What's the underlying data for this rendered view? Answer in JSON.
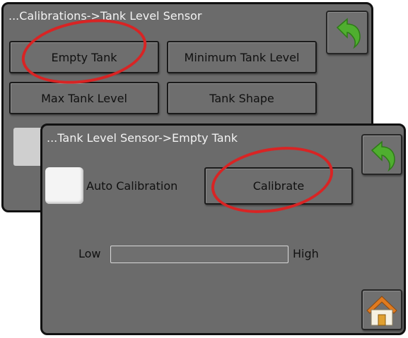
{
  "back_screen": {
    "breadcrumb": "...Calibrations->Tank Level Sensor",
    "buttons": {
      "empty_tank": "Empty Tank",
      "minimum_tank_level": "Minimum Tank Level",
      "max_tank_level": "Max Tank Level",
      "tank_shape": "Tank Shape"
    },
    "back_icon": "back-arrow-icon"
  },
  "front_screen": {
    "breadcrumb": "...Tank Level Sensor->Empty Tank",
    "auto_calibration_label": "Auto Calibration",
    "calibrate_button": "Calibrate",
    "bar_low_label": "Low",
    "bar_high_label": "High",
    "back_icon": "back-arrow-icon",
    "home_icon": "home-icon"
  },
  "colors": {
    "panel_bg": "#6b6b6b",
    "highlight_ellipse": "#d82424",
    "back_arrow": "#4fae2f",
    "home_roof": "#e07a1f"
  }
}
